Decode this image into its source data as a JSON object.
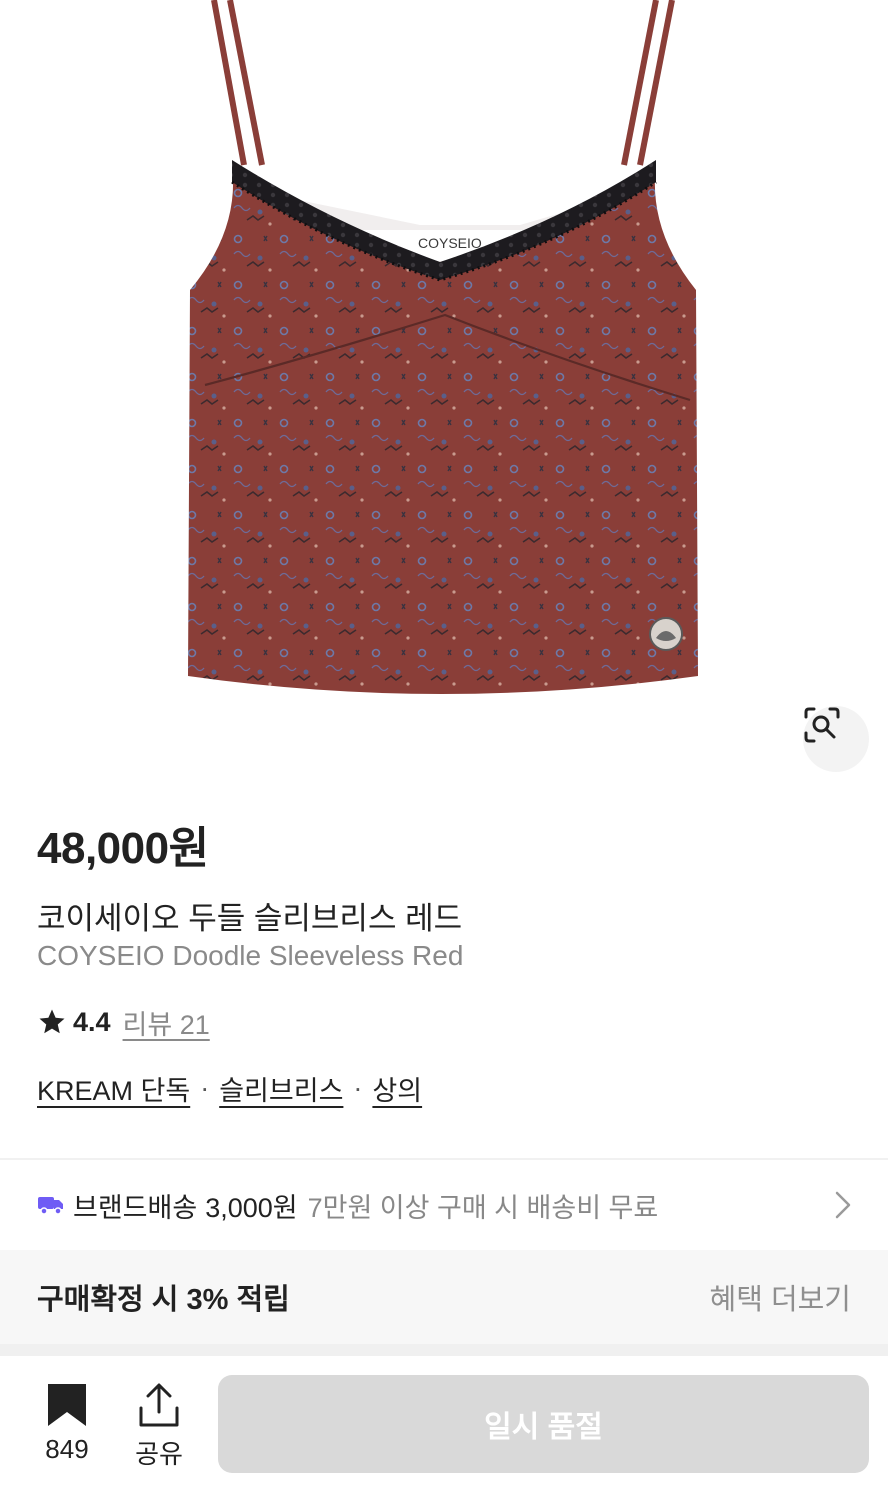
{
  "product": {
    "price": "48,000원",
    "name_ko": "코이세이오 두들 슬리브리스 레드",
    "name_en": "COYSEIO Doodle Sleeveless Red",
    "rating": "4.4",
    "review_text": "리뷰 21",
    "tags": [
      "KREAM 단독",
      "슬리브리스",
      "상의"
    ],
    "image_icon": "lens-search-icon",
    "garment_color": "#8a3e38",
    "label_text": "COYSEIO"
  },
  "shipping": {
    "icon": "truck-icon",
    "icon_color": "#6f5cf5",
    "label": "브랜드배송",
    "fee": "3,000원",
    "note": "7만원 이상 구매 시 배송비 무료"
  },
  "benefit": {
    "title": "구매확정 시 3% 적립",
    "more": "혜택 더보기"
  },
  "bottom_bar": {
    "bookmark_count": "849",
    "share_label": "공유",
    "purchase_button": "일시 품절"
  }
}
